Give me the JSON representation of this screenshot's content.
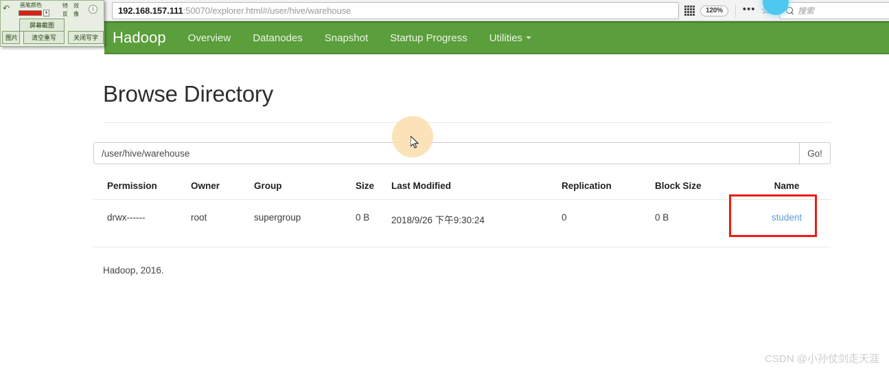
{
  "browser": {
    "url_host": "192.168.157.111",
    "url_rest": ":50070/explorer.html#/user/hive/warehouse",
    "zoom_level": "120%",
    "reader_icon": "reader-view-icon",
    "menu_icon": "ellipsis-menu-icon",
    "bookmark_icon": "star-bookmark-icon",
    "search_placeholder": "搜索",
    "search_value": ""
  },
  "navbar": {
    "brand": "Hadoop",
    "links": [
      {
        "label": "Overview"
      },
      {
        "label": "Datanodes"
      },
      {
        "label": "Snapshot"
      },
      {
        "label": "Startup Progress"
      },
      {
        "label": "Utilities",
        "has_caret": true
      }
    ],
    "color": "#5b9e3c"
  },
  "page": {
    "title": "Browse Directory",
    "path_value": "/user/hive/warehouse",
    "path_placeholder": "",
    "go_label": "Go!",
    "footer": "Hadoop, 2016."
  },
  "table": {
    "headers": [
      "Permission",
      "Owner",
      "Group",
      "Size",
      "Last Modified",
      "Replication",
      "Block Size",
      "Name"
    ],
    "rows": [
      {
        "permission": "drwx------",
        "owner": "root",
        "group": "supergroup",
        "size": "0 B",
        "last_modified": "2018/9/26 下午9:30:24",
        "replication": "0",
        "block_size": "0 B",
        "name": "student"
      }
    ]
  },
  "annotations": {
    "highlight_box_color": "#ee1b11",
    "click_halo_color": "#fbdfb0",
    "blue_marker_color": "#4fc8f0"
  },
  "anno_toolbar": {
    "pen_color_label": "画笔颜色",
    "pen_color_value": "#e21b10",
    "swatch_arrow": "▾",
    "screenshot_label": "屏幕截图",
    "image_label": "图片",
    "clear_label": "清空重写",
    "effects_label": "特　效",
    "invert_label": "反　像",
    "close_label": "关闭写字",
    "info_glyph": "i",
    "undo_glyph": "↶"
  },
  "watermark": "CSDN @小孙仗剑走天涯"
}
